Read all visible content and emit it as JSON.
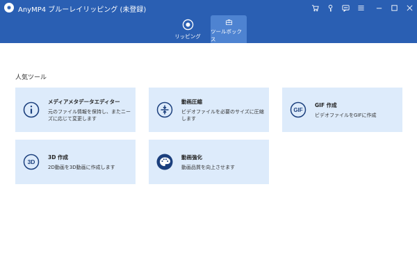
{
  "app": {
    "title": "AnyMP4 ブルーレイリッピング (未登録)"
  },
  "window_icons": [
    "cart-icon",
    "key-icon",
    "chat-icon",
    "menu-icon",
    "minimize-icon",
    "maximize-icon",
    "close-icon"
  ],
  "tabs": [
    {
      "label": "リッピング",
      "icon": "disc-icon",
      "active": false
    },
    {
      "label": "ツールボックス",
      "icon": "toolbox-icon",
      "active": true
    }
  ],
  "section": {
    "title": "人気ツール"
  },
  "tools": [
    {
      "title": "メディアメタデータエディター",
      "desc": "元のファイル情報を保持し、またニーズに応じて変更します",
      "icon": "info-icon"
    },
    {
      "title": "動画圧縮",
      "desc": "ビデオファイルを必要のサイズに圧縮します",
      "icon": "compress-icon"
    },
    {
      "title": "GIF 作成",
      "desc": "ビデオファイルをGIFに作成",
      "icon": "gif-icon"
    },
    {
      "title": "3D 作成",
      "desc": "2D動画を3D動画に作成します",
      "icon": "3d-icon"
    },
    {
      "title": "動画強化",
      "desc": "動画品質を向上させます",
      "icon": "palette-icon"
    }
  ],
  "colors": {
    "header": "#2a5fb3",
    "active_tab": "#4e83d1",
    "card_bg": "#ddebfb",
    "icon": "#1b3f7d"
  }
}
